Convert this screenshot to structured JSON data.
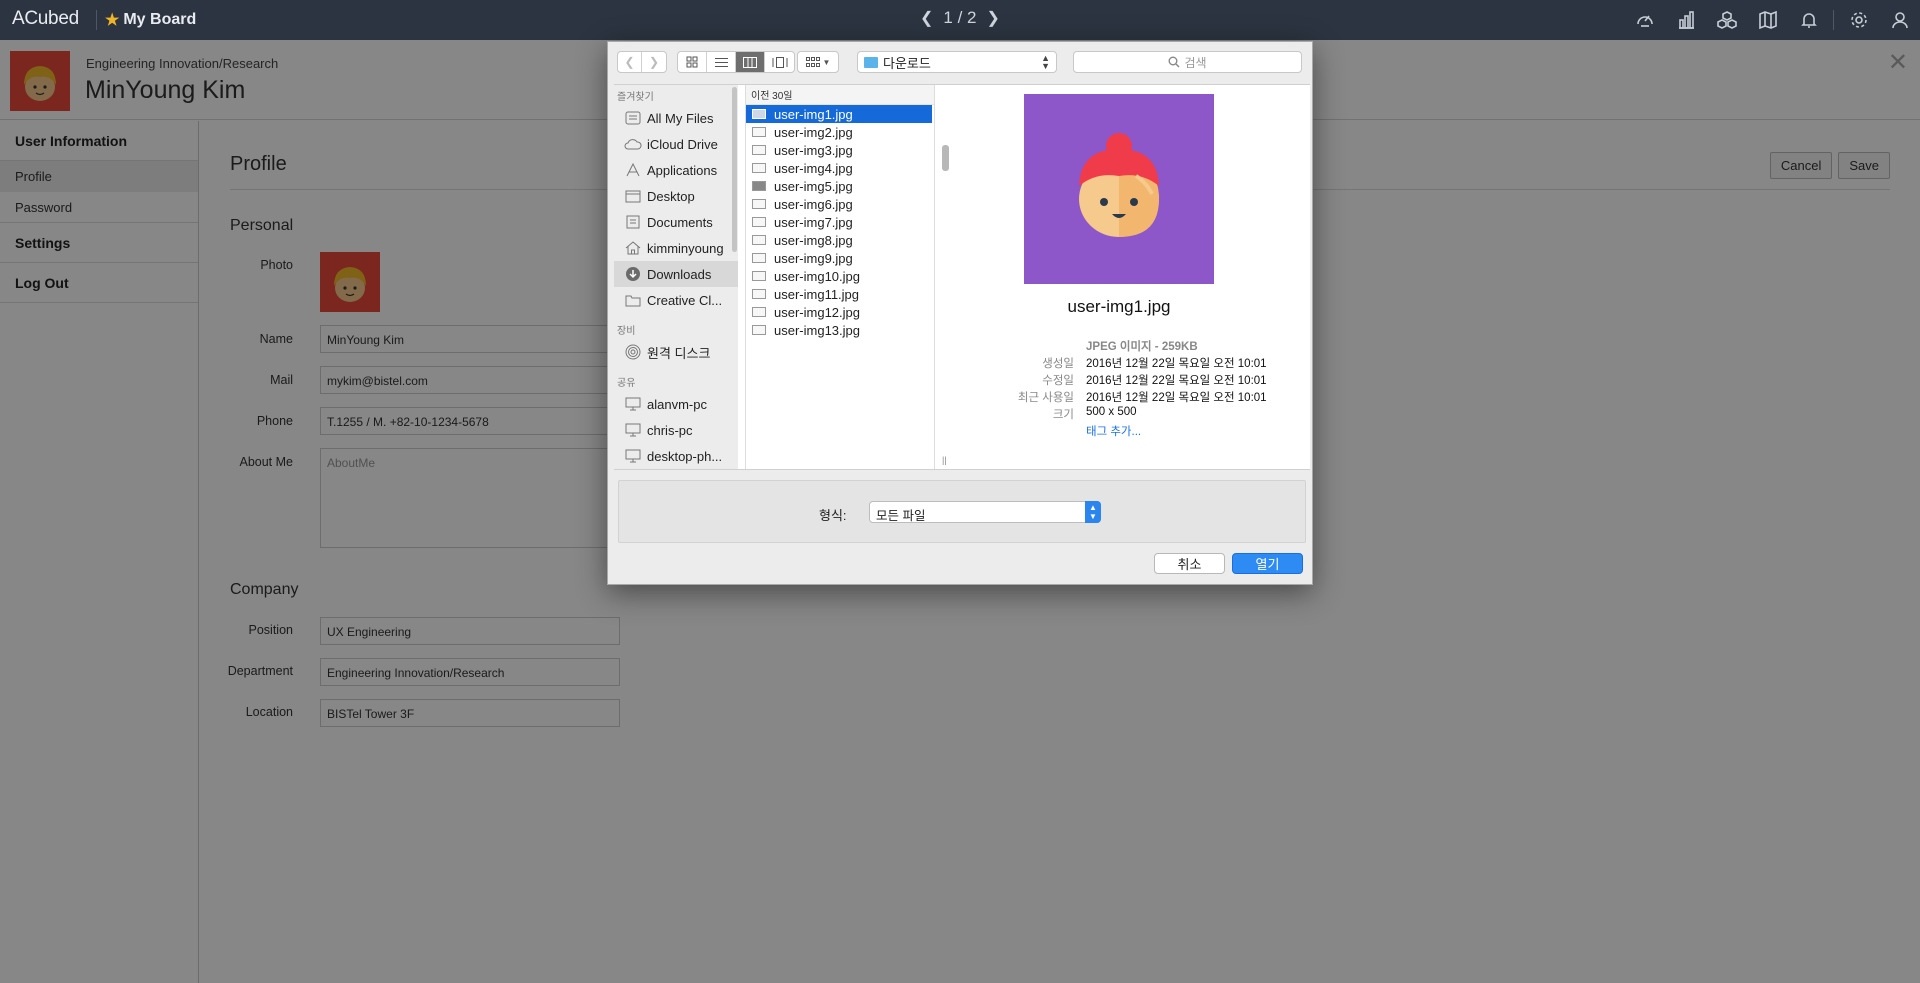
{
  "topbar": {
    "logo": "ACubed",
    "board_label": "My Board",
    "pager": "1 / 2",
    "icons": [
      "dashboard-icon",
      "chart-icon",
      "cubes-icon",
      "map-icon",
      "bell-icon",
      "gear-icon",
      "user-icon"
    ]
  },
  "user": {
    "org": "Engineering Innovation/Research",
    "name": "MinYoung Kim"
  },
  "sidebar": {
    "sections": [
      {
        "label": "User Information",
        "items": [
          {
            "label": "Profile",
            "active": true
          },
          {
            "label": "Password",
            "active": false
          }
        ]
      },
      {
        "label": "Settings"
      },
      {
        "label": "Log Out"
      }
    ]
  },
  "profile": {
    "title": "Profile",
    "cancel_label": "Cancel",
    "save_label": "Save",
    "personal_title": "Personal",
    "photo_label": "Photo",
    "name_label": "Name",
    "name_value": "MinYoung Kim",
    "mail_label": "Mail",
    "mail_value": "mykim@bistel.com",
    "phone_label": "Phone",
    "phone_value": "T.1255 / M. +82-10-1234-5678",
    "about_label": "About Me",
    "about_placeholder": "AboutMe",
    "company_title": "Company",
    "position_label": "Position",
    "position_value": "UX Engineering",
    "department_label": "Department",
    "department_value": "Engineering Innovation/Research",
    "location_label": "Location",
    "location_value": "BISTel Tower 3F"
  },
  "dialog": {
    "location": "다운로드",
    "search_placeholder": "검색",
    "favorites_header": "즐겨찾기",
    "favorites": [
      "All My Files",
      "iCloud Drive",
      "Applications",
      "Desktop",
      "Documents",
      "kimminyoung",
      "Downloads",
      "Creative Cl..."
    ],
    "devices_header": "장비",
    "devices": [
      "원격 디스크"
    ],
    "shared_header": "공유",
    "shared": [
      "alanvm-pc",
      "chris-pc",
      "desktop-ph..."
    ],
    "column_header": "이전 30일",
    "files": [
      "user-img1.jpg",
      "user-img2.jpg",
      "user-img3.jpg",
      "user-img4.jpg",
      "user-img5.jpg",
      "user-img6.jpg",
      "user-img7.jpg",
      "user-img8.jpg",
      "user-img9.jpg",
      "user-img10.jpg",
      "user-img11.jpg",
      "user-img12.jpg",
      "user-img13.jpg"
    ],
    "selected_file": "user-img1.jpg",
    "preview": {
      "name": "user-img1.jpg",
      "type": "JPEG 이미지 - 259KB",
      "meta": [
        {
          "k": "생성일",
          "v": "2016년 12월 22일 목요일 오전 10:01"
        },
        {
          "k": "수정일",
          "v": "2016년 12월 22일 목요일 오전 10:01"
        },
        {
          "k": "최근 사용일",
          "v": "2016년 12월 22일 목요일 오전 10:01"
        },
        {
          "k": "크기",
          "v": "500 x 500"
        }
      ],
      "add_tag": "태그 추가..."
    },
    "format_label": "형식:",
    "format_value": "모든 파일",
    "cancel_label": "취소",
    "open_label": "열기"
  },
  "colors": {
    "topbar": "#2b3440",
    "avatar_bg": "#e8493b",
    "preview_bg": "#8e57c9",
    "selection": "#1569d8",
    "primary_button": "#2e8bf3"
  }
}
